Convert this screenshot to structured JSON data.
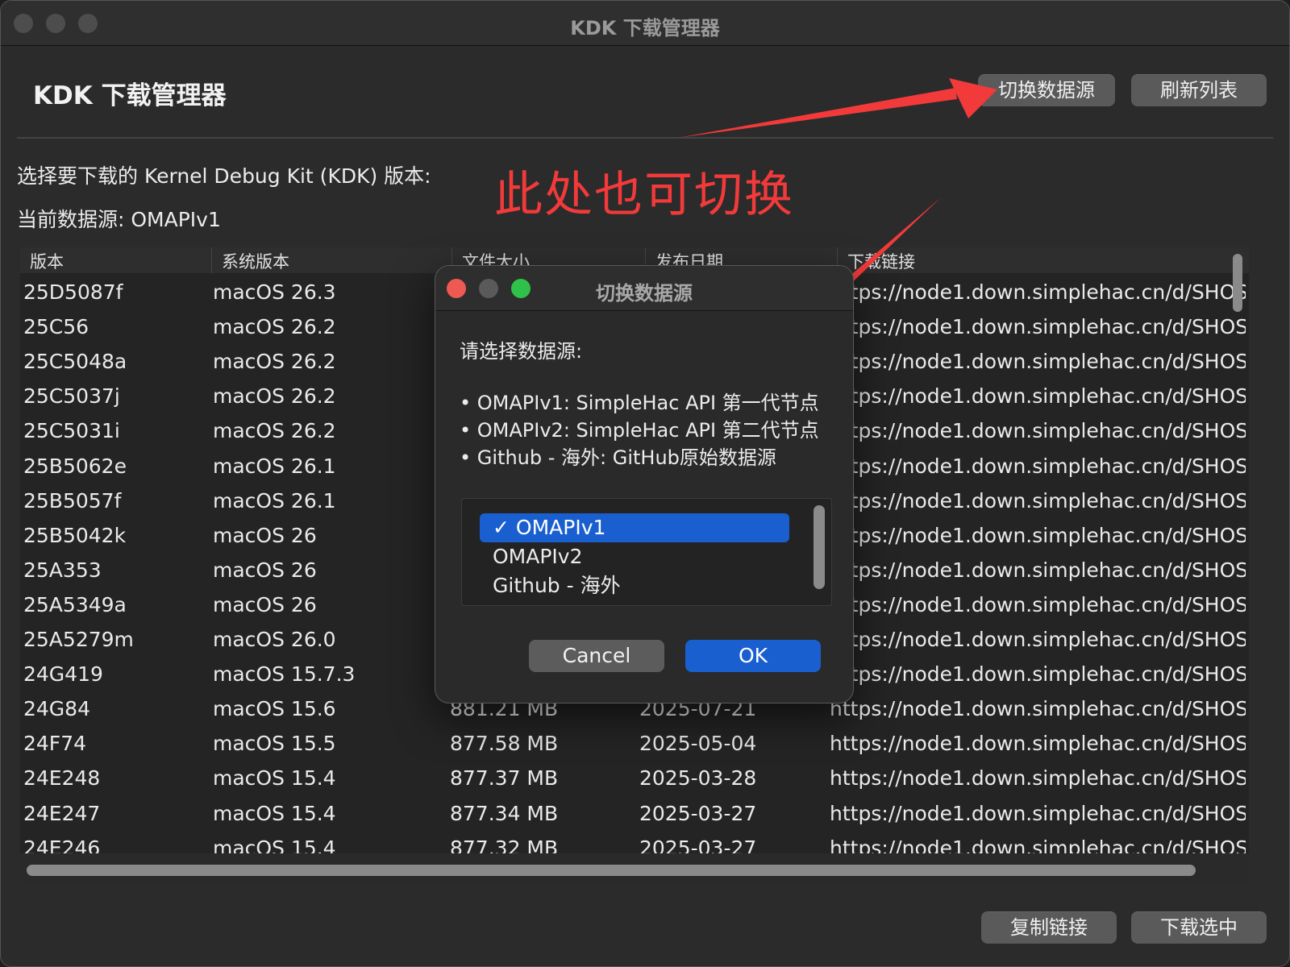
{
  "window": {
    "title": "KDK 下载管理器"
  },
  "header": {
    "title": "KDK 下载管理器",
    "switch_source_label": "切换数据源",
    "refresh_label": "刷新列表"
  },
  "prompt": "选择要下载的 Kernel Debug Kit (KDK) 版本:",
  "current_source": "当前数据源: OMAPIv1",
  "annotation": "此处也可切换",
  "table": {
    "columns": [
      "版本",
      "系统版本",
      "文件大小",
      "发布日期",
      "下载链接"
    ],
    "rows": [
      [
        "25D5087f",
        "macOS 26.3",
        "",
        "",
        "https://node1.down.simplehac.cn/d/SHOS"
      ],
      [
        "25C56",
        "macOS 26.2",
        "",
        "",
        "https://node1.down.simplehac.cn/d/SHOS"
      ],
      [
        "25C5048a",
        "macOS 26.2",
        "",
        "",
        "https://node1.down.simplehac.cn/d/SHOS"
      ],
      [
        "25C5037j",
        "macOS 26.2",
        "",
        "",
        "https://node1.down.simplehac.cn/d/SHOS"
      ],
      [
        "25C5031i",
        "macOS 26.2",
        "",
        "",
        "https://node1.down.simplehac.cn/d/SHOS"
      ],
      [
        "25B5062e",
        "macOS 26.1",
        "",
        "",
        "https://node1.down.simplehac.cn/d/SHOS"
      ],
      [
        "25B5057f",
        "macOS 26.1",
        "",
        "",
        "https://node1.down.simplehac.cn/d/SHOS"
      ],
      [
        "25B5042k",
        "macOS 26",
        "",
        "",
        "https://node1.down.simplehac.cn/d/SHOS"
      ],
      [
        "25A353",
        "macOS 26",
        "",
        "",
        "https://node1.down.simplehac.cn/d/SHOS"
      ],
      [
        "25A5349a",
        "macOS 26",
        "",
        "",
        "https://node1.down.simplehac.cn/d/SHOS"
      ],
      [
        "25A5279m",
        "macOS 26.0",
        "",
        "",
        "https://node1.down.simplehac.cn/d/SHOS"
      ],
      [
        "24G419",
        "macOS 15.7.3",
        "",
        "",
        "https://node1.down.simplehac.cn/d/SHOS"
      ],
      [
        "24G84",
        "macOS 15.6",
        "881.21 MB",
        "2025-07-21",
        "https://node1.down.simplehac.cn/d/SHOS"
      ],
      [
        "24F74",
        "macOS 15.5",
        "877.58 MB",
        "2025-05-04",
        "https://node1.down.simplehac.cn/d/SHOS"
      ],
      [
        "24E248",
        "macOS 15.4",
        "877.37 MB",
        "2025-03-28",
        "https://node1.down.simplehac.cn/d/SHOS"
      ],
      [
        "24E247",
        "macOS 15.4",
        "877.34 MB",
        "2025-03-27",
        "https://node1.down.simplehac.cn/d/SHOS"
      ],
      [
        "24E246",
        "macOS 15.4",
        "877.32 MB",
        "2025-03-27",
        "https://node1.down.simplehac.cn/d/SHOS"
      ]
    ]
  },
  "footer": {
    "copy_link_label": "复制链接",
    "download_selected_label": "下载选中"
  },
  "dialog": {
    "title": "切换数据源",
    "prompt": "请选择数据源:",
    "descriptions": [
      "• OMAPIv1: SimpleHac API 第一代节点",
      "• OMAPIv2: SimpleHac API 第二代节点",
      "• Github - 海外: GitHub原始数据源"
    ],
    "options": [
      "✓ OMAPIv1",
      "OMAPIv2",
      "Github - 海外"
    ],
    "selected_index": 0,
    "cancel_label": "Cancel",
    "ok_label": "OK"
  },
  "colors": {
    "accent": "#1a5fd0",
    "annotation": "#f23a3a",
    "close": "#ee5a52",
    "minimize": "#5a5a5a",
    "zoom": "#2fc14a"
  }
}
